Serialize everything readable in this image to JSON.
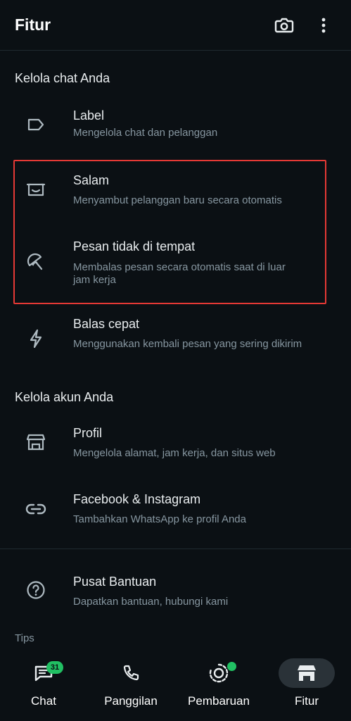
{
  "header": {
    "title": "Fitur",
    "camera_icon": "camera-icon",
    "menu_icon": "more-vertical-icon"
  },
  "sections": {
    "chat_manage_title": "Kelola chat Anda",
    "account_manage_title": "Kelola akun Anda",
    "tips_title": "Tips"
  },
  "items": {
    "label": {
      "title": "Label",
      "subtitle": "Mengelola chat dan pelanggan",
      "icon": "label-icon"
    },
    "greeting": {
      "title": "Salam",
      "subtitle": "Menyambut pelanggan baru secara otomatis",
      "icon": "greeting-icon"
    },
    "away": {
      "title": "Pesan tidak di tempat",
      "subtitle": "Membalas pesan secara otomatis saat di luar jam kerja",
      "icon": "away-umbrella-icon"
    },
    "quick_reply": {
      "title": "Balas cepat",
      "subtitle": "Menggunakan kembali pesan yang sering dikirim",
      "icon": "lightning-icon"
    },
    "profile": {
      "title": "Profil",
      "subtitle": "Mengelola alamat, jam kerja, dan situs web",
      "icon": "storefront-icon"
    },
    "fb_ig": {
      "title": "Facebook & Instagram",
      "subtitle": "Tambahkan WhatsApp ke profil Anda",
      "icon": "link-icon"
    },
    "help": {
      "title": "Pusat Bantuan",
      "subtitle": "Dapatkan bantuan, hubungi kami",
      "icon": "help-circle-icon"
    }
  },
  "bottom_nav": {
    "chat": {
      "label": "Chat",
      "badge": "31"
    },
    "calls": {
      "label": "Panggilan"
    },
    "updates": {
      "label": "Pembaruan"
    },
    "tools": {
      "label": "Fitur"
    }
  },
  "colors": {
    "background": "#0b1014",
    "accent": "#21c063",
    "highlight_border": "#e53935",
    "secondary_text": "#8696a0"
  }
}
